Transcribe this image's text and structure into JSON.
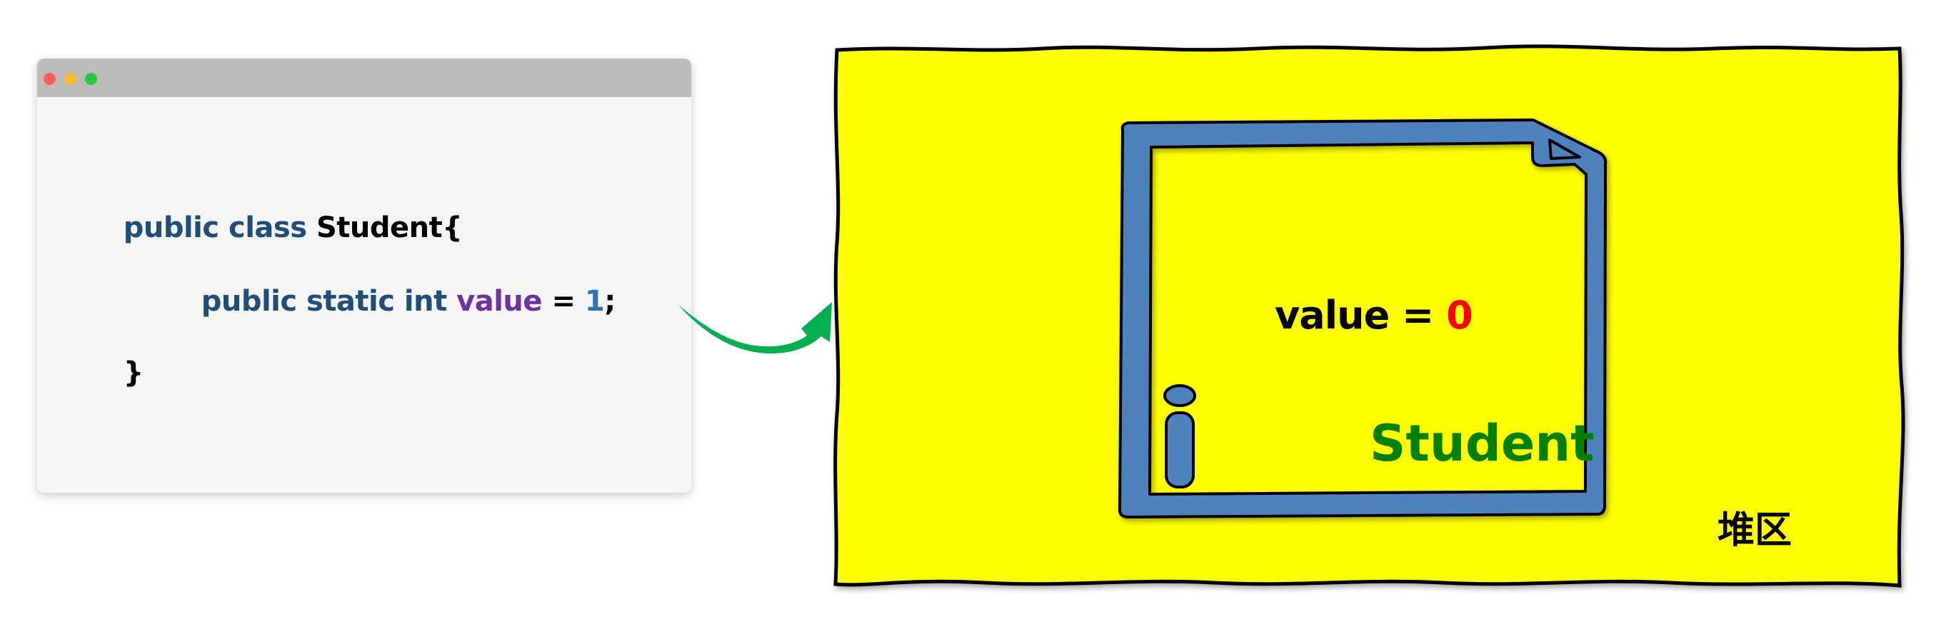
{
  "colors": {
    "keyword": "#1f4e79",
    "variable": "#7030a0",
    "number": "#2e75b6",
    "plain": "#000000",
    "heap_fill": "#ffff00",
    "object_blue": "#4f81bd",
    "arrow_green": "#00b050",
    "student_green": "#008000",
    "value_red": "#ff0000",
    "dot_red": "#ff5f57",
    "dot_yellow": "#febc2e",
    "dot_green": "#28c840"
  },
  "code": {
    "line1": {
      "kw": "public class ",
      "name": "Student{"
    },
    "line2": {
      "kw": "public static int ",
      "var": "value",
      "eq": " = ",
      "num": "1",
      "semi": ";"
    },
    "line3": {
      "brace": "}"
    }
  },
  "heap": {
    "label": "堆区",
    "object_name": "Student",
    "field_name": "value",
    "field_eq": " = ",
    "field_value": "0",
    "info_icon": "info-icon"
  }
}
